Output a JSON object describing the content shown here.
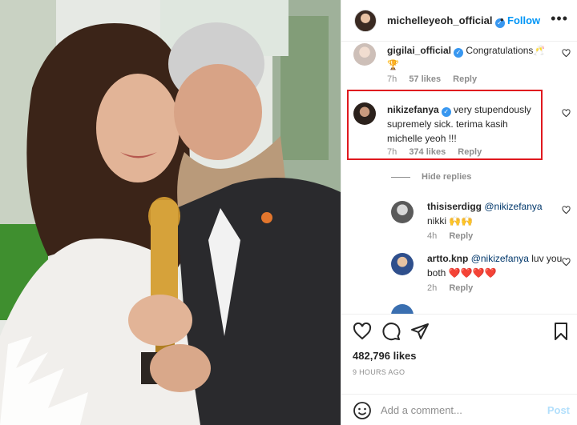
{
  "header": {
    "username": "michelleyeoh_official",
    "separator": "•",
    "follow_label": "Follow",
    "more_label": "•••"
  },
  "comments": [
    {
      "username": "gigilai_official",
      "verified": true,
      "text": "Congratulations🥂🏆",
      "time": "7h",
      "likes": "57 likes",
      "reply": "Reply"
    },
    {
      "username": "nikizefanya",
      "verified": true,
      "text": "very stupendously supremely sick. terima kasih michelle yeoh !!!",
      "time": "7h",
      "likes": "374 likes",
      "reply": "Reply",
      "highlighted": true
    }
  ],
  "hide_replies_label": "Hide replies",
  "replies": [
    {
      "username": "thisiserdigg",
      "mention": "@nikizefanya",
      "text": "nikki 🙌🙌",
      "time": "4h",
      "reply": "Reply"
    },
    {
      "username": "artto.knp",
      "mention": "@nikizefanya",
      "text": "luv you both ❤️❤️❤️❤️",
      "time": "2h",
      "reply": "Reply"
    }
  ],
  "post": {
    "likes": "482,796 likes",
    "time_ago": "9 HOURS AGO",
    "comment_placeholder": "Add a comment...",
    "post_label": "Post"
  },
  "colors": {
    "accent": "#0095f6",
    "highlight": "#e0191f",
    "verified": "#3897f0",
    "muted": "#8e8e8e"
  }
}
